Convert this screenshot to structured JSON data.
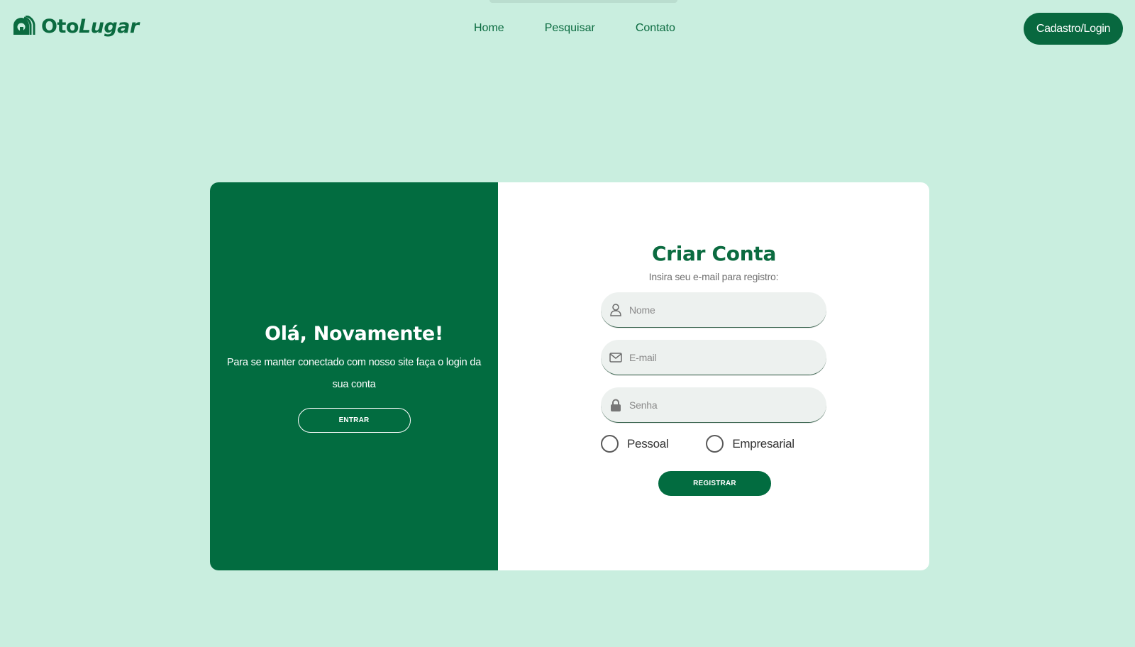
{
  "header": {
    "logo": {
      "brand_part1": "Oto",
      "brand_part2": "Lugar"
    },
    "nav": [
      {
        "label": "Home"
      },
      {
        "label": "Pesquisar"
      },
      {
        "label": "Contato"
      }
    ],
    "cta_label": "Cadastro/Login"
  },
  "left_panel": {
    "title": "Olá, Novamente!",
    "text": "Para se manter conectado com nosso site faça o login da sua conta",
    "button_label": "ENTRAR"
  },
  "form": {
    "title": "Criar Conta",
    "subtitle": "Insira seu e-mail para registro:",
    "fields": [
      {
        "placeholder": "Nome",
        "icon": "user-icon"
      },
      {
        "placeholder": "E-mail",
        "icon": "envelope-icon"
      },
      {
        "placeholder": "Senha",
        "icon": "lock-icon"
      }
    ],
    "radios": [
      {
        "label": "Pessoal"
      },
      {
        "label": "Empresarial"
      }
    ],
    "submit_label": "REGISTRAR"
  },
  "colors": {
    "page_bg": "#c9eedf",
    "brand_green": "#026c40",
    "card_bg": "#ffffff",
    "field_bg": "#edf1ef"
  }
}
